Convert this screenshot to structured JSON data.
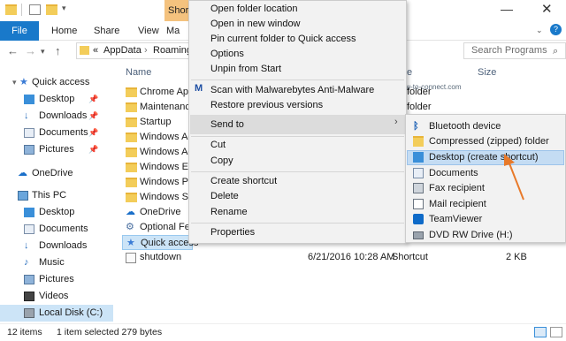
{
  "ribbon": {
    "tabs": [
      "File",
      "Home",
      "Share",
      "View"
    ],
    "manage_tab": "Short",
    "view_tab_partial": "Ma"
  },
  "address": {
    "path_prefix": "«",
    "path": [
      "AppData",
      "Roaming"
    ],
    "search_placeholder": "Search Programs"
  },
  "nav": {
    "items": [
      {
        "label": "Quick access",
        "icon": "star-icon",
        "pinned": false
      },
      {
        "label": "Desktop",
        "icon": "desktop-icon",
        "pinned": true
      },
      {
        "label": "Downloads",
        "icon": "download-icon",
        "pinned": true
      },
      {
        "label": "Documents",
        "icon": "documents-icon",
        "pinned": true
      },
      {
        "label": "Pictures",
        "icon": "pictures-icon",
        "pinned": true
      },
      {
        "label": "OneDrive",
        "icon": "cloud-icon",
        "pinned": false
      },
      {
        "label": "This PC",
        "icon": "pc-icon",
        "pinned": false
      },
      {
        "label": "Desktop",
        "icon": "desktop-icon",
        "pinned": false
      },
      {
        "label": "Documents",
        "icon": "documents-icon",
        "pinned": false
      },
      {
        "label": "Downloads",
        "icon": "download-icon",
        "pinned": false
      },
      {
        "label": "Music",
        "icon": "music-icon",
        "pinned": false
      },
      {
        "label": "Pictures",
        "icon": "pictures-icon",
        "pinned": false
      },
      {
        "label": "Videos",
        "icon": "videos-icon",
        "pinned": false
      },
      {
        "label": "Local Disk (C:)",
        "icon": "disk-icon",
        "pinned": false
      }
    ]
  },
  "columns": {
    "name": "Name",
    "size": "Size",
    "type_partial": "e"
  },
  "files": [
    {
      "name": "Chrome App",
      "kind": "folder",
      "date": "",
      "type": "folder",
      "size": ""
    },
    {
      "name": "Maintenance",
      "kind": "folder",
      "date": "",
      "type": "folder",
      "size": ""
    },
    {
      "name": "Startup",
      "kind": "folder",
      "date": "",
      "type": "",
      "size": ""
    },
    {
      "name": "Windows Ac",
      "kind": "folder",
      "date": "",
      "type": "",
      "size": ""
    },
    {
      "name": "Windows Ad",
      "kind": "folder",
      "date": "",
      "type": "",
      "size": ""
    },
    {
      "name": "Windows Eas",
      "kind": "folder",
      "date": "",
      "type": "",
      "size": ""
    },
    {
      "name": "Windows Po",
      "kind": "folder",
      "date": "",
      "type": "",
      "size": ""
    },
    {
      "name": "Windows Sys",
      "kind": "folder",
      "date": "",
      "type": "",
      "size": ""
    },
    {
      "name": "OneDrive",
      "kind": "shortcut",
      "date": "",
      "type": "",
      "size": ""
    },
    {
      "name": "Optional Fea",
      "kind": "shortcut",
      "date": "",
      "type": "",
      "size": ""
    },
    {
      "name": "Quick access",
      "kind": "shortcut",
      "date": "",
      "type": "",
      "size": ""
    },
    {
      "name": "shutdown",
      "kind": "shortcut",
      "date": "6/21/2016 10:28 AM",
      "type": "Shortcut",
      "size": "2 KB"
    }
  ],
  "context_menu": {
    "items": [
      "Open folder location",
      "Open in new window",
      "Pin current folder to Quick access",
      "Options",
      "Unpin from Start",
      "Scan with Malwarebytes Anti-Malware",
      "Restore previous versions",
      "Send to",
      "Cut",
      "Copy",
      "Create shortcut",
      "Delete",
      "Rename",
      "Properties"
    ]
  },
  "send_to": {
    "items": [
      {
        "label": "Bluetooth device",
        "icon": "bluetooth-icon"
      },
      {
        "label": "Compressed (zipped) folder",
        "icon": "zip-folder-icon"
      },
      {
        "label": "Desktop (create shortcut)",
        "icon": "desktop-icon"
      },
      {
        "label": "Documents",
        "icon": "documents-icon"
      },
      {
        "label": "Fax recipient",
        "icon": "fax-icon"
      },
      {
        "label": "Mail recipient",
        "icon": "mail-icon"
      },
      {
        "label": "TeamViewer",
        "icon": "teamviewer-icon"
      },
      {
        "label": "DVD RW Drive (H:)",
        "icon": "dvd-icon"
      }
    ],
    "highlighted_index": 2
  },
  "status": {
    "items": "12 items",
    "selected": "1 item selected 279 bytes"
  },
  "watermark": "@How-to-connect.com",
  "colors": {
    "accent": "#1979ca",
    "manage": "#f4c27e",
    "arrow": "#e87a2a",
    "highlight": "#c4dcf3"
  }
}
